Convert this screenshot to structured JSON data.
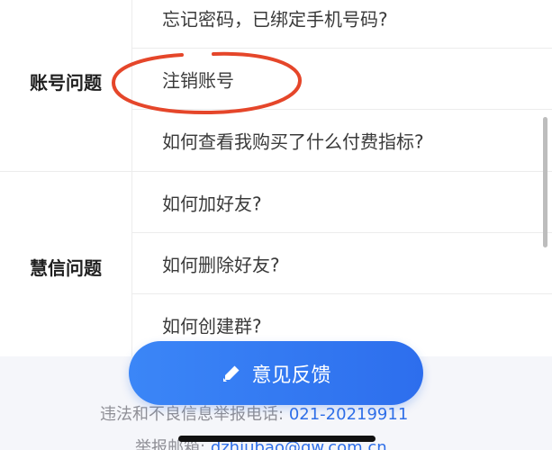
{
  "groups": [
    {
      "label": "账号问题",
      "questions": [
        "忘记密码，已绑定手机号码?",
        "注销账号",
        "如何查看我购买了什么付费指标?"
      ]
    },
    {
      "label": "慧信问题",
      "questions": [
        "如何加好友?",
        "如何删除好友?",
        "如何创建群?"
      ]
    }
  ],
  "feedback": {
    "label": "意见反馈",
    "icon": "pencil-icon",
    "color": "#2f6fe8"
  },
  "footer": {
    "report_phone_label": "违法和不良信息举报电话:",
    "report_phone_value": "021-20219911",
    "report_email_label": "举报邮箱:",
    "report_email_value": "dzhiubao@gw.com.cn"
  },
  "annotation": {
    "circle_color": "#e5462a"
  }
}
